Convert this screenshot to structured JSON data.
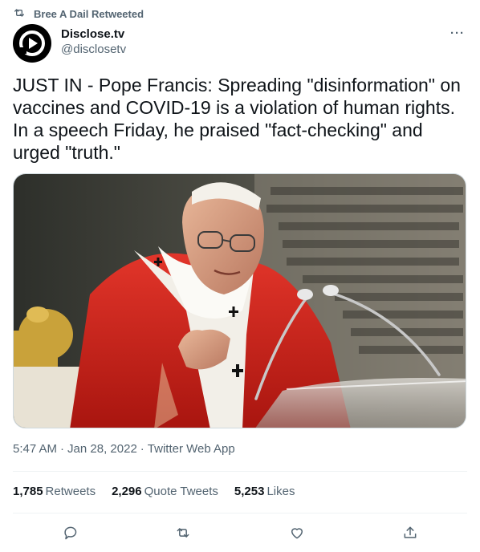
{
  "retweet_header": {
    "text": "Bree A Dail Retweeted",
    "icon": "retweet-icon"
  },
  "author": {
    "display_name": "Disclose.tv",
    "handle": "@disclosetv",
    "avatar_icon": "disclose-logo"
  },
  "more_label": "···",
  "tweet": {
    "text": "JUST IN - Pope Francis: Spreading \"disinformation\" on\nvaccines and COVID-19 is a violation of human rights.\nIn a speech Friday, he praised \"fact-checking\" and\nurged \"truth.\""
  },
  "meta": {
    "time": "5:47 AM",
    "sep1": "·",
    "date": "Jan 28, 2022",
    "sep2": "·",
    "source": "Twitter Web App"
  },
  "stats": {
    "retweets_count": "1,785",
    "retweets_label": "Retweets",
    "quotes_count": "2,296",
    "quotes_label": "Quote Tweets",
    "likes_count": "5,253",
    "likes_label": "Likes"
  },
  "actions": [
    "reply-icon",
    "retweet-icon",
    "like-icon",
    "share-icon"
  ],
  "colors": {
    "text": "#0f1419",
    "secondary": "#536471",
    "border": "#cfd9de",
    "divider": "#eff3f4"
  }
}
